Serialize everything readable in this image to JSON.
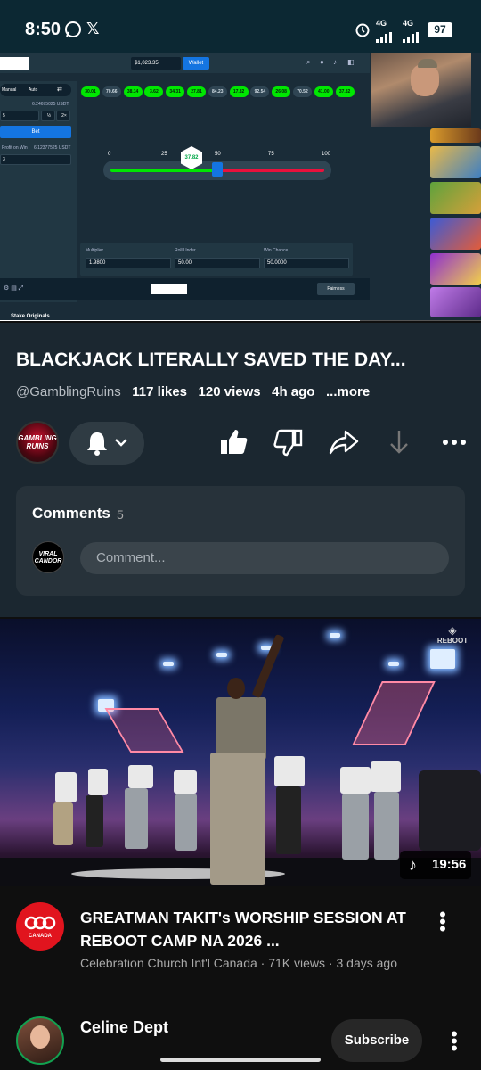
{
  "status_bar": {
    "time": "8:50",
    "network_1": "4G",
    "network_2": "4G",
    "battery": "97"
  },
  "player": {
    "wallet_balance": "$1,023.35",
    "wallet_button": "Wallet",
    "mode_tabs": [
      "Manual",
      "Auto"
    ],
    "side_values": {
      "bet_amount_usdt": "6.24675025 USDT",
      "half": "½",
      "double": "2×",
      "bet_button": "Bet",
      "profit_label": "Profit on Win",
      "profit_usdt": "6.12377525 USDT"
    },
    "recent_results": [
      {
        "v": "30.01",
        "win": true
      },
      {
        "v": "70.66",
        "win": false
      },
      {
        "v": "38.14",
        "win": true
      },
      {
        "v": "3.62",
        "win": true
      },
      {
        "v": "34.31",
        "win": true
      },
      {
        "v": "27.81",
        "win": true
      },
      {
        "v": "84.23",
        "win": false
      },
      {
        "v": "17.82",
        "win": true
      },
      {
        "v": "92.54",
        "win": false
      },
      {
        "v": "26.08",
        "win": true
      },
      {
        "v": "70.52",
        "win": false
      },
      {
        "v": "41.00",
        "win": true
      },
      {
        "v": "37.82",
        "win": true
      }
    ],
    "slider_ticks": [
      "0",
      "25",
      "50",
      "75",
      "100"
    ],
    "rolled_value": "37.82",
    "roll_under_fraction": 0.5,
    "stats": {
      "multiplier_label": "Multiplier",
      "multiplier_value": "1.9800",
      "roll_label": "Roll Under",
      "roll_value": "50.00",
      "chance_label": "Win Chance",
      "chance_value": "50.0000"
    },
    "fairness": "Fairness",
    "originals": "Stake Originals",
    "progress_fraction": 0.748
  },
  "video": {
    "title": "BLACKJACK LITERALLY SAVED THE DAY...",
    "channel": "@GamblingRuins",
    "likes": "117 likes",
    "views": "120 views",
    "age": "4h ago",
    "more": "...more",
    "channel_avatar_text": "GAMBLING RUINS"
  },
  "comments": {
    "heading": "Comments",
    "count": "5",
    "placeholder": "Comment...",
    "user_avatar_text": "VIRAL CANDOR"
  },
  "next_video": {
    "duration": "19:56",
    "watermark": "REBOOT",
    "title": "GREATMAN TAKIT's WORSHIP SESSION AT REBOOT CAMP NA 2026 ...",
    "meta": "Celebration Church Int'l Canada · 71K views · 3 days ago",
    "channel_avatar_text": "CANADA"
  },
  "third_item": {
    "name": "Celine Dept",
    "subscribe": "Subscribe"
  }
}
